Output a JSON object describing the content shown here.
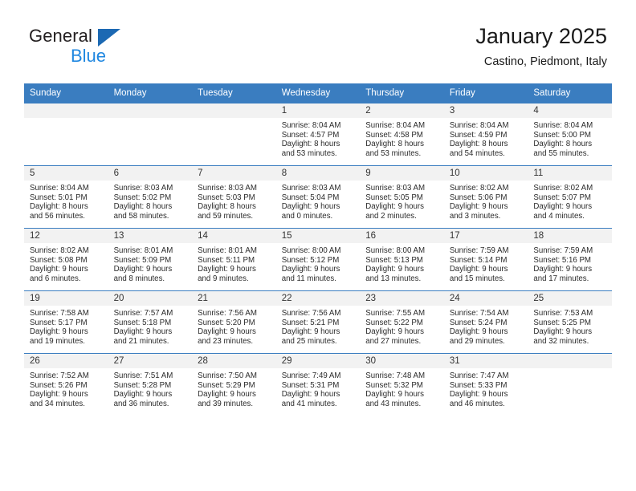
{
  "brand": {
    "name_top": "General",
    "name_bottom": "Blue",
    "accent_color": "#1f87e0",
    "triangle_color": "#1c69b3"
  },
  "header": {
    "title": "January 2025",
    "subtitle": "Castino, Piedmont, Italy",
    "header_bg": "#3a7dc0",
    "daynum_bg": "#f2f2f2"
  },
  "weekday_headers": [
    "Sunday",
    "Monday",
    "Tuesday",
    "Wednesday",
    "Thursday",
    "Friday",
    "Saturday"
  ],
  "weeks": [
    [
      {
        "day": "",
        "empty": true
      },
      {
        "day": "",
        "empty": true
      },
      {
        "day": "",
        "empty": true
      },
      {
        "day": "1",
        "sunrise": "Sunrise: 8:04 AM",
        "sunset": "Sunset: 4:57 PM",
        "daylight_1": "Daylight: 8 hours",
        "daylight_2": "and 53 minutes."
      },
      {
        "day": "2",
        "sunrise": "Sunrise: 8:04 AM",
        "sunset": "Sunset: 4:58 PM",
        "daylight_1": "Daylight: 8 hours",
        "daylight_2": "and 53 minutes."
      },
      {
        "day": "3",
        "sunrise": "Sunrise: 8:04 AM",
        "sunset": "Sunset: 4:59 PM",
        "daylight_1": "Daylight: 8 hours",
        "daylight_2": "and 54 minutes."
      },
      {
        "day": "4",
        "sunrise": "Sunrise: 8:04 AM",
        "sunset": "Sunset: 5:00 PM",
        "daylight_1": "Daylight: 8 hours",
        "daylight_2": "and 55 minutes."
      }
    ],
    [
      {
        "day": "5",
        "sunrise": "Sunrise: 8:04 AM",
        "sunset": "Sunset: 5:01 PM",
        "daylight_1": "Daylight: 8 hours",
        "daylight_2": "and 56 minutes."
      },
      {
        "day": "6",
        "sunrise": "Sunrise: 8:03 AM",
        "sunset": "Sunset: 5:02 PM",
        "daylight_1": "Daylight: 8 hours",
        "daylight_2": "and 58 minutes."
      },
      {
        "day": "7",
        "sunrise": "Sunrise: 8:03 AM",
        "sunset": "Sunset: 5:03 PM",
        "daylight_1": "Daylight: 8 hours",
        "daylight_2": "and 59 minutes."
      },
      {
        "day": "8",
        "sunrise": "Sunrise: 8:03 AM",
        "sunset": "Sunset: 5:04 PM",
        "daylight_1": "Daylight: 9 hours",
        "daylight_2": "and 0 minutes."
      },
      {
        "day": "9",
        "sunrise": "Sunrise: 8:03 AM",
        "sunset": "Sunset: 5:05 PM",
        "daylight_1": "Daylight: 9 hours",
        "daylight_2": "and 2 minutes."
      },
      {
        "day": "10",
        "sunrise": "Sunrise: 8:02 AM",
        "sunset": "Sunset: 5:06 PM",
        "daylight_1": "Daylight: 9 hours",
        "daylight_2": "and 3 minutes."
      },
      {
        "day": "11",
        "sunrise": "Sunrise: 8:02 AM",
        "sunset": "Sunset: 5:07 PM",
        "daylight_1": "Daylight: 9 hours",
        "daylight_2": "and 4 minutes."
      }
    ],
    [
      {
        "day": "12",
        "sunrise": "Sunrise: 8:02 AM",
        "sunset": "Sunset: 5:08 PM",
        "daylight_1": "Daylight: 9 hours",
        "daylight_2": "and 6 minutes."
      },
      {
        "day": "13",
        "sunrise": "Sunrise: 8:01 AM",
        "sunset": "Sunset: 5:09 PM",
        "daylight_1": "Daylight: 9 hours",
        "daylight_2": "and 8 minutes."
      },
      {
        "day": "14",
        "sunrise": "Sunrise: 8:01 AM",
        "sunset": "Sunset: 5:11 PM",
        "daylight_1": "Daylight: 9 hours",
        "daylight_2": "and 9 minutes."
      },
      {
        "day": "15",
        "sunrise": "Sunrise: 8:00 AM",
        "sunset": "Sunset: 5:12 PM",
        "daylight_1": "Daylight: 9 hours",
        "daylight_2": "and 11 minutes."
      },
      {
        "day": "16",
        "sunrise": "Sunrise: 8:00 AM",
        "sunset": "Sunset: 5:13 PM",
        "daylight_1": "Daylight: 9 hours",
        "daylight_2": "and 13 minutes."
      },
      {
        "day": "17",
        "sunrise": "Sunrise: 7:59 AM",
        "sunset": "Sunset: 5:14 PM",
        "daylight_1": "Daylight: 9 hours",
        "daylight_2": "and 15 minutes."
      },
      {
        "day": "18",
        "sunrise": "Sunrise: 7:59 AM",
        "sunset": "Sunset: 5:16 PM",
        "daylight_1": "Daylight: 9 hours",
        "daylight_2": "and 17 minutes."
      }
    ],
    [
      {
        "day": "19",
        "sunrise": "Sunrise: 7:58 AM",
        "sunset": "Sunset: 5:17 PM",
        "daylight_1": "Daylight: 9 hours",
        "daylight_2": "and 19 minutes."
      },
      {
        "day": "20",
        "sunrise": "Sunrise: 7:57 AM",
        "sunset": "Sunset: 5:18 PM",
        "daylight_1": "Daylight: 9 hours",
        "daylight_2": "and 21 minutes."
      },
      {
        "day": "21",
        "sunrise": "Sunrise: 7:56 AM",
        "sunset": "Sunset: 5:20 PM",
        "daylight_1": "Daylight: 9 hours",
        "daylight_2": "and 23 minutes."
      },
      {
        "day": "22",
        "sunrise": "Sunrise: 7:56 AM",
        "sunset": "Sunset: 5:21 PM",
        "daylight_1": "Daylight: 9 hours",
        "daylight_2": "and 25 minutes."
      },
      {
        "day": "23",
        "sunrise": "Sunrise: 7:55 AM",
        "sunset": "Sunset: 5:22 PM",
        "daylight_1": "Daylight: 9 hours",
        "daylight_2": "and 27 minutes."
      },
      {
        "day": "24",
        "sunrise": "Sunrise: 7:54 AM",
        "sunset": "Sunset: 5:24 PM",
        "daylight_1": "Daylight: 9 hours",
        "daylight_2": "and 29 minutes."
      },
      {
        "day": "25",
        "sunrise": "Sunrise: 7:53 AM",
        "sunset": "Sunset: 5:25 PM",
        "daylight_1": "Daylight: 9 hours",
        "daylight_2": "and 32 minutes."
      }
    ],
    [
      {
        "day": "26",
        "sunrise": "Sunrise: 7:52 AM",
        "sunset": "Sunset: 5:26 PM",
        "daylight_1": "Daylight: 9 hours",
        "daylight_2": "and 34 minutes."
      },
      {
        "day": "27",
        "sunrise": "Sunrise: 7:51 AM",
        "sunset": "Sunset: 5:28 PM",
        "daylight_1": "Daylight: 9 hours",
        "daylight_2": "and 36 minutes."
      },
      {
        "day": "28",
        "sunrise": "Sunrise: 7:50 AM",
        "sunset": "Sunset: 5:29 PM",
        "daylight_1": "Daylight: 9 hours",
        "daylight_2": "and 39 minutes."
      },
      {
        "day": "29",
        "sunrise": "Sunrise: 7:49 AM",
        "sunset": "Sunset: 5:31 PM",
        "daylight_1": "Daylight: 9 hours",
        "daylight_2": "and 41 minutes."
      },
      {
        "day": "30",
        "sunrise": "Sunrise: 7:48 AM",
        "sunset": "Sunset: 5:32 PM",
        "daylight_1": "Daylight: 9 hours",
        "daylight_2": "and 43 minutes."
      },
      {
        "day": "31",
        "sunrise": "Sunrise: 7:47 AM",
        "sunset": "Sunset: 5:33 PM",
        "daylight_1": "Daylight: 9 hours",
        "daylight_2": "and 46 minutes."
      },
      {
        "day": "",
        "empty": true
      }
    ]
  ]
}
